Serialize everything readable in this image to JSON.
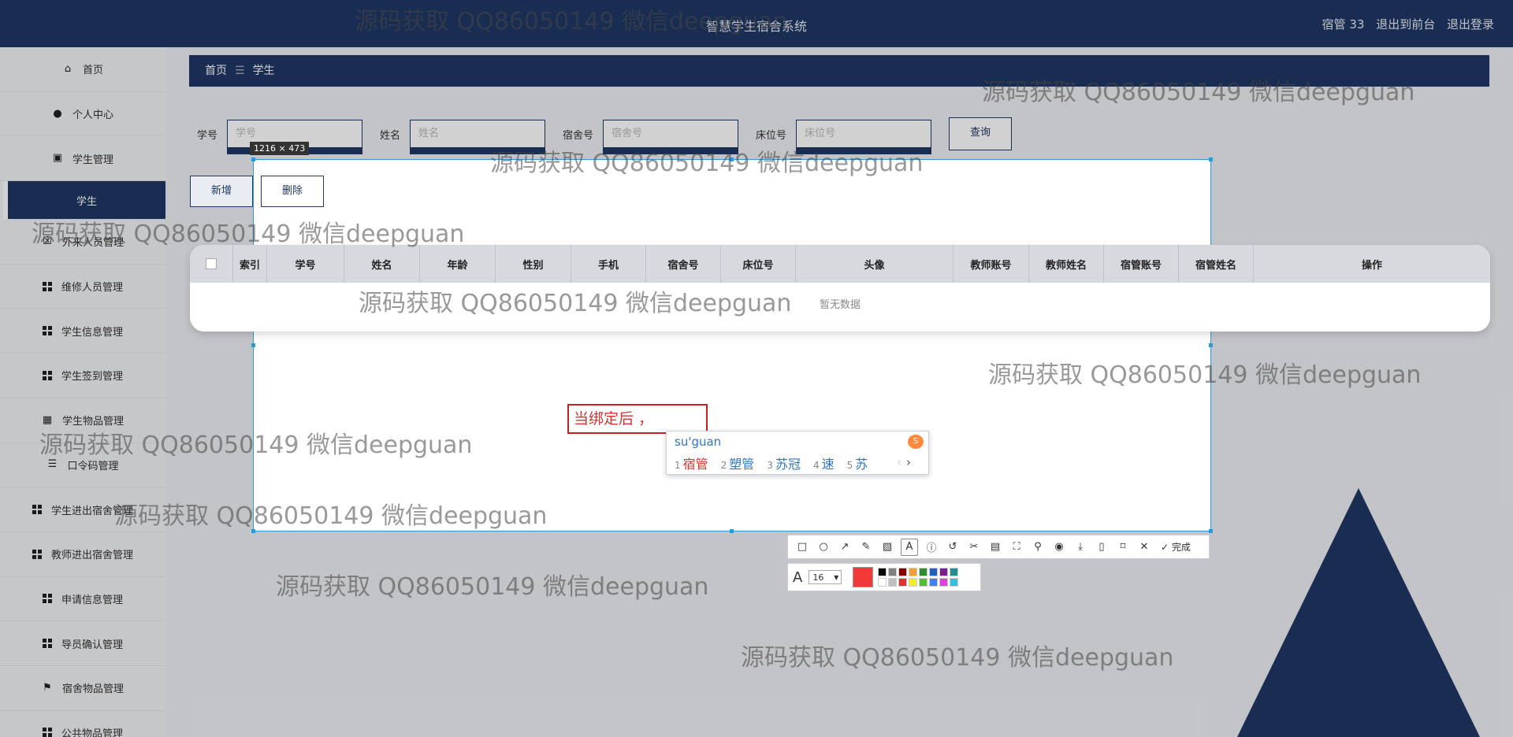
{
  "header": {
    "system_title": "智慧学生宿舍系统",
    "user_label": "宿管 33",
    "front_link": "退出到前台",
    "logout_link": "退出登录"
  },
  "sidebar": {
    "items": [
      {
        "label": "首页",
        "icon": "home-icon"
      },
      {
        "label": "个人中心",
        "icon": "user-icon"
      },
      {
        "label": "学生管理",
        "icon": "clipboard-icon"
      },
      {
        "label": "学生",
        "icon": "",
        "active": true
      },
      {
        "label": "外来人员管理",
        "icon": "close-box-icon"
      },
      {
        "label": "维修人员管理",
        "icon": "grid-icon"
      },
      {
        "label": "学生信息管理",
        "icon": "grid-icon"
      },
      {
        "label": "学生签到管理",
        "icon": "grid-icon"
      },
      {
        "label": "学生物品管理",
        "icon": "grid-icon"
      },
      {
        "label": "口令码管理",
        "icon": "list-icon"
      },
      {
        "label": "学生进出宿舍管理",
        "icon": "grid-icon"
      },
      {
        "label": "教师进出宿舍管理",
        "icon": "grid-icon"
      },
      {
        "label": "申请信息管理",
        "icon": "grid-icon"
      },
      {
        "label": "导员确认管理",
        "icon": "grid-icon"
      },
      {
        "label": "宿舍物品管理",
        "icon": "flag-icon"
      },
      {
        "label": "公共物品管理",
        "icon": "grid-icon"
      }
    ]
  },
  "breadcrumb": {
    "home": "首页",
    "sep": "☰",
    "current": "学生"
  },
  "filters": [
    {
      "label": "学号",
      "placeholder": "学号"
    },
    {
      "label": "姓名",
      "placeholder": "姓名"
    },
    {
      "label": "宿舍号",
      "placeholder": "宿舍号"
    },
    {
      "label": "床位号",
      "placeholder": "床位号"
    }
  ],
  "query_button": "查询",
  "add_button": "新增",
  "delete_button": "删除",
  "table": {
    "columns": [
      "索引",
      "学号",
      "姓名",
      "年龄",
      "性别",
      "手机",
      "宿舍号",
      "床位号",
      "头像",
      "教师账号",
      "教师姓名",
      "宿管账号",
      "宿管姓名",
      "操作"
    ],
    "empty_text": "暂无数据"
  },
  "capture": {
    "size_label": "1216 × 473",
    "text_box": "当绑定后 ，"
  },
  "ime": {
    "pinyin": "su'guan",
    "candidates": [
      {
        "n": "1",
        "text": "宿管"
      },
      {
        "n": "2",
        "text": "塑管"
      },
      {
        "n": "3",
        "text": "苏冠"
      },
      {
        "n": "4",
        "text": "速"
      },
      {
        "n": "5",
        "text": "苏"
      }
    ],
    "next": "›",
    "prev": "‹"
  },
  "toolbar": {
    "done_label": "完成",
    "font_size": "16"
  },
  "palette": [
    "#000000",
    "#808080",
    "#800000",
    "#f0a030",
    "#2e8b2e",
    "#1f5fbf",
    "#7a1f8f",
    "#1f8f8f",
    "#ffffff",
    "#c0c0c0",
    "#e03030",
    "#f0f020",
    "#50c030",
    "#4080f0",
    "#e040e0",
    "#30c0e0"
  ],
  "current_color": "#f03a3a",
  "watermark": "源码获取 QQ86050149 微信deepguan"
}
